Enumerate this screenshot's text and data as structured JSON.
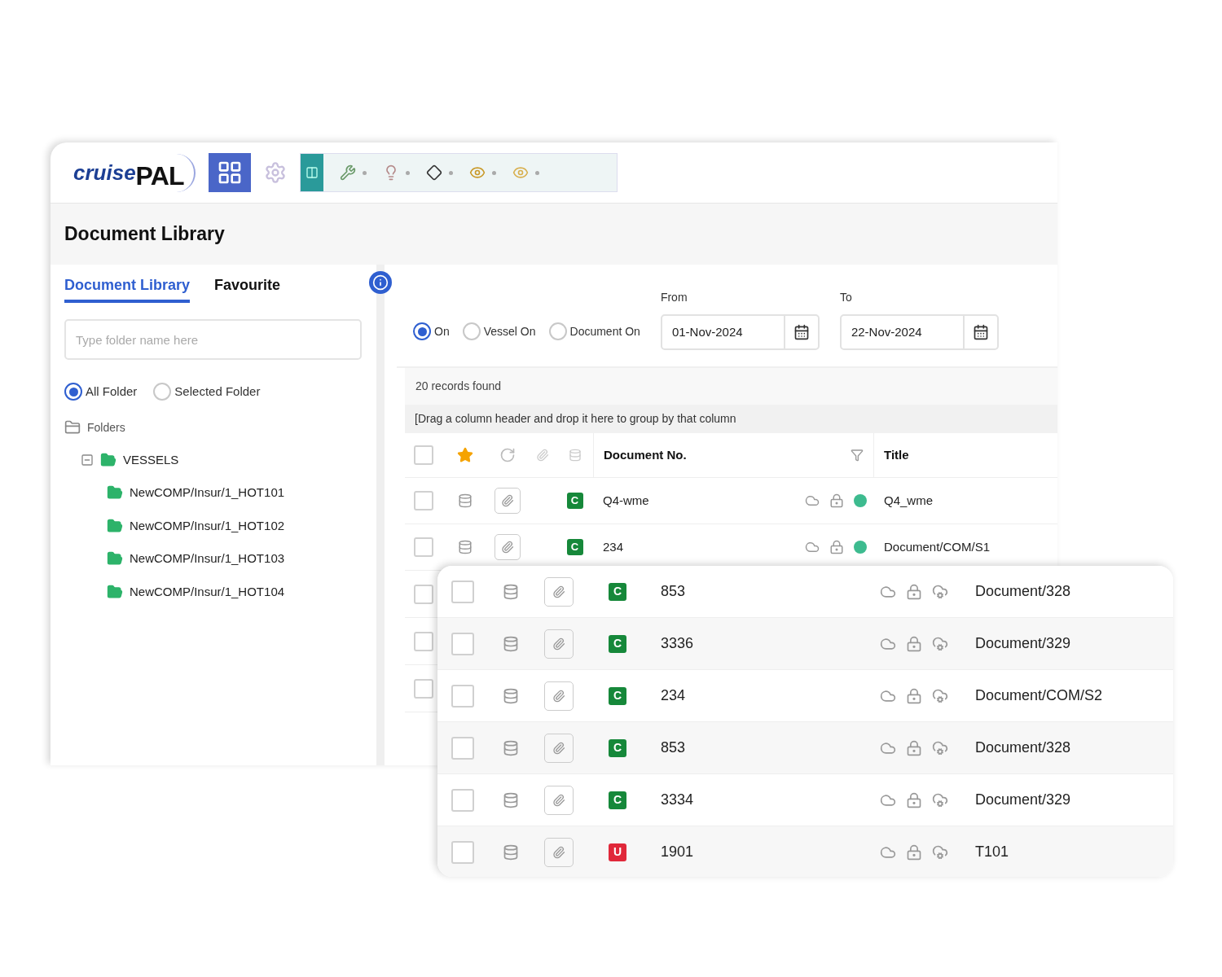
{
  "app": {
    "logo_part_1": "cruise",
    "logo_part_2": "PAL"
  },
  "page_title": "Document Library",
  "side_tabs": [
    {
      "label": "Document Library",
      "selected": true
    },
    {
      "label": "Favourite",
      "selected": false
    }
  ],
  "folder_search": {
    "placeholder": "Type folder name here"
  },
  "folder_scope": [
    {
      "label": "All Folder",
      "selected": true
    },
    {
      "label": "Selected Folder",
      "selected": false
    }
  ],
  "folders": {
    "label": "Folders",
    "tree": [
      {
        "name": "VESSELS",
        "expanded": true,
        "children": [
          {
            "name": "NewCOMP/Insur/1_HOT101"
          },
          {
            "name": "NewCOMP/Insur/1_HOT102"
          },
          {
            "name": "NewCOMP/Insur/1_HOT103"
          },
          {
            "name": "NewCOMP/Insur/1_HOT104"
          }
        ]
      }
    ]
  },
  "date_mode": [
    {
      "label": "On",
      "selected": true
    },
    {
      "label": "Vessel On",
      "selected": false
    },
    {
      "label": "Document On",
      "selected": false
    }
  ],
  "from": {
    "label": "From",
    "value": "01-Nov-2024"
  },
  "to": {
    "label": "To",
    "value": "22-Nov-2024"
  },
  "records_found": "20 records found",
  "group_hint": "[Drag a column header and drop it here to group by that column",
  "table": {
    "select_all": {
      "checked": false
    },
    "columns": [
      "Document No.",
      "Title"
    ],
    "rows": [
      {
        "checked": false,
        "status": "C",
        "color": "#16883a",
        "document_no": "Q4-wme",
        "title": "Q4_wme",
        "online": true
      },
      {
        "checked": false,
        "status": "C",
        "color": "#16883a",
        "document_no": "234",
        "title": "Document/COM/S1",
        "online": true
      }
    ],
    "covered_rows": [
      {
        "checked": false
      },
      {
        "checked": false
      },
      {
        "checked": false
      }
    ]
  },
  "zoom_card": {
    "rows": [
      {
        "checked": false,
        "status": "C",
        "color": "#16883a",
        "document_no": "853",
        "title": "Document/328",
        "online": false
      },
      {
        "checked": false,
        "status": "C",
        "color": "#16883a",
        "document_no": "3336",
        "title": "Document/329",
        "online": false
      },
      {
        "checked": false,
        "status": "C",
        "color": "#16883a",
        "document_no": "234",
        "title": "Document/COM/S2",
        "online": false
      },
      {
        "checked": false,
        "status": "C",
        "color": "#16883a",
        "document_no": "853",
        "title": "Document/328",
        "online": false
      },
      {
        "checked": false,
        "status": "C",
        "color": "#16883a",
        "document_no": "3334",
        "title": "Document/329",
        "online": false
      },
      {
        "checked": false,
        "status": "U",
        "color": "#e0283a",
        "document_no": "1901",
        "title": "T101",
        "online": false
      }
    ]
  }
}
